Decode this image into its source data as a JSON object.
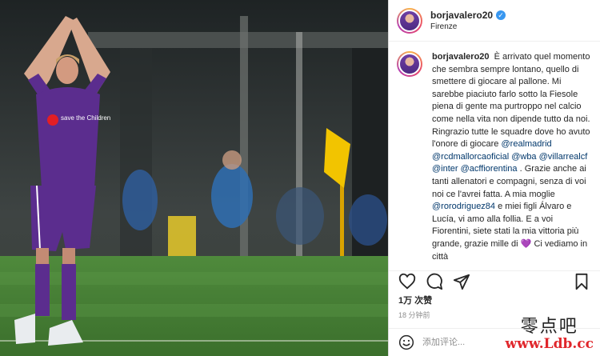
{
  "post": {
    "username": "borjavalero20",
    "location": "Firenze",
    "caption": {
      "intro": "È arrivato quel momento che sembra sempre lontano, quello di smettere di giocare al pallone. Mi sarebbe piaciuto farlo sotto la Fiesole piena di gente ma purtroppo nel calcio come nella vita non dipende tutto da noi. Ringrazio tutte le squadre dove ho avuto l'onore di giocare",
      "mention_realmadrid": "@realmadrid",
      "mention_rcdmallorca": "@rcdmallorcaoficial",
      "mention_wba": "@wba",
      "mention_villarreal": "@villarrealcf",
      "mention_inter": "@inter",
      "mention_fiorentina": "@acffiorentina",
      "dot": ".",
      "middle": "Grazie anche ai tanti allenatori e compagni, senza di voi noi ce l'avrei fatta. A mia moglie",
      "mention_wife": "@rorodriguez84",
      "ending": "e miei figli Álvaro e Lucía, vi amo alla follia. E a voi Fiorentini, siete stati la mia vittoria più grande, grazie mille di",
      "last_line": "Ci vediamo in città"
    },
    "likes": "1万 次赞",
    "time": "18 分钟前",
    "comment_placeholder": "添加评论..."
  },
  "photo": {
    "jersey_sponsor": "save the Children"
  },
  "watermark": {
    "top": "零点吧",
    "bottom": "www.Ldb.cc"
  },
  "icons": [
    "heart-icon",
    "comment-icon",
    "share-icon",
    "bookmark-icon",
    "emoji-icon",
    "verified-badge-icon"
  ],
  "colors": {
    "verified": "#3897f0",
    "mention": "#00376b",
    "jersey": "#5b2d8e",
    "watermark_red": "#e0262b"
  }
}
